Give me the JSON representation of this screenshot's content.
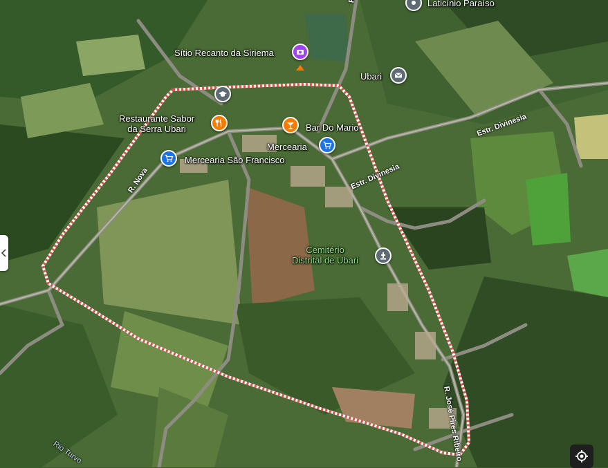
{
  "colors": {
    "boundary": "#d9534f",
    "food_pin": "#f57c00",
    "shop_pin": "#1a73e8",
    "civic_pin": "#5f6b73",
    "leisure_pin": "#a142f4",
    "cemetery_label": "#8fe18a"
  },
  "places": {
    "laticinio": "Laticínio Paraíso",
    "sitio": "Sítio Recanto da Siriema",
    "ubari_post": "Ubari",
    "restaurante_l1": "Restaurante Sabor",
    "restaurante_l2": "da Serra Ubari",
    "bar": "Bar Do Mario",
    "mercearia": "Mercearia",
    "mercearia_sf": "Mercearia São Francisco",
    "cemiterio_l1": "Cemitério",
    "cemiterio_l2": "Distrital de Ubari"
  },
  "roads": {
    "divinesia_east": "Estr. Divinesia",
    "divinesia": "Estr. Divinesia",
    "nova": "R. Nova",
    "jose_pires": "R. José Pires Ribeiro",
    "rio_turvo": "Rio Turvo",
    "top_road": "R"
  },
  "icons": {
    "pin_poi": "map-pin-icon",
    "restaurant": "fork-knife-icon",
    "bar": "cocktail-icon",
    "shop": "shopping-cart-icon",
    "mail": "envelope-icon",
    "school": "graduation-cap-icon",
    "photo": "camera-icon",
    "cemetery": "monument-icon",
    "locate": "my-location-icon"
  }
}
